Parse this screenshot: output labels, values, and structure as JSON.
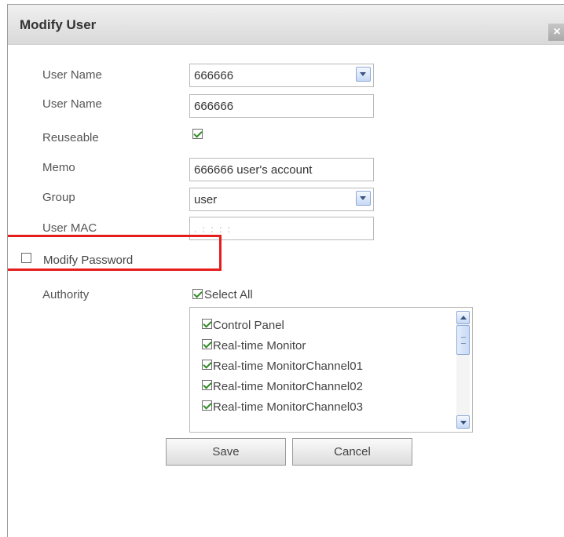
{
  "dialog": {
    "title": "Modify User",
    "close_glyph": "×"
  },
  "form": {
    "user_name_select": {
      "label": "User Name",
      "value": "666666"
    },
    "user_name_field": {
      "label": "User Name",
      "value": "666666"
    },
    "reuseable": {
      "label": "Reuseable",
      "checked": true
    },
    "memo": {
      "label": "Memo",
      "value": "666666 user's account"
    },
    "group": {
      "label": "Group",
      "value": "user"
    },
    "user_mac": {
      "label": "User MAC",
      "value": ".    :    :    :    :"
    },
    "modify_password": {
      "label": "Modify Password",
      "checked": false
    },
    "authority": {
      "label": "Authority",
      "select_all_label": "Select All",
      "select_all_checked": true,
      "items": [
        "Control Panel",
        "Real-time Monitor",
        "Real-time MonitorChannel01",
        "Real-time MonitorChannel02",
        "Real-time MonitorChannel03"
      ]
    }
  },
  "buttons": {
    "save_label": "Save",
    "cancel_label": "Cancel"
  },
  "colors": {
    "highlight": "#e41d1d",
    "check": "#2e8b22",
    "scroll_accent": "#8faad6"
  }
}
